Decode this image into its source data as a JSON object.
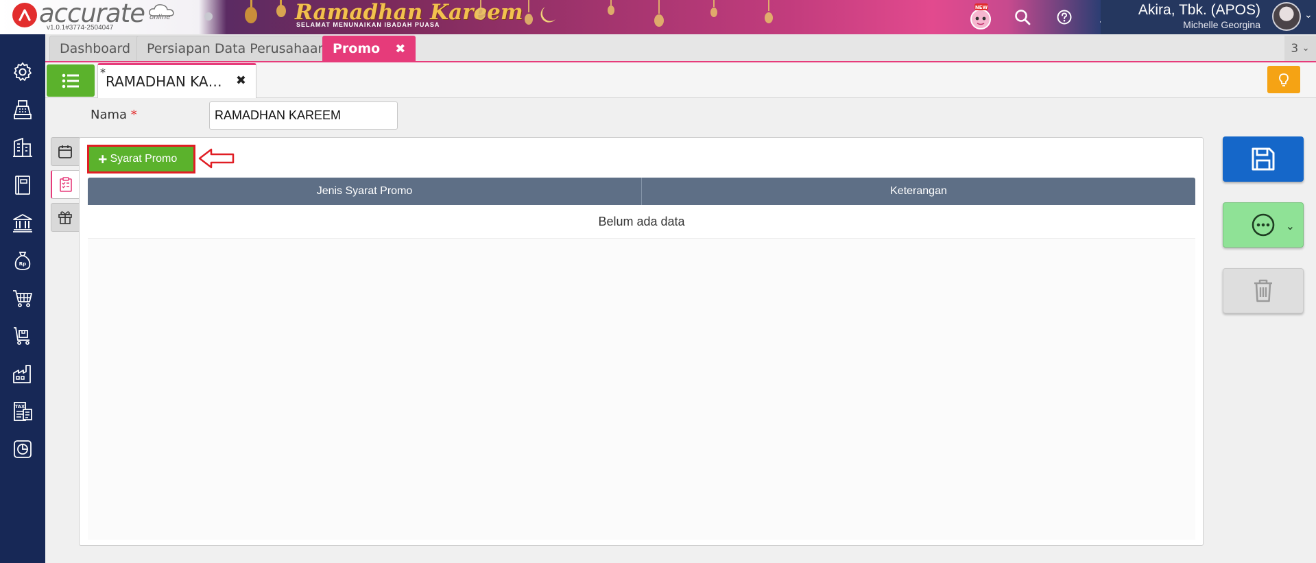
{
  "app": {
    "logo_text": "accurate",
    "logo_online": "online",
    "version": "v1.0.1#3774-2504047",
    "banner_title": "Ramadhan Kareem",
    "banner_subtitle": "SELAMAT MENUNAIKAN IBADAH PUASA",
    "new_badge": "NEW"
  },
  "user": {
    "company": "Akira, Tbk. (APOS)",
    "name": "Michelle Georgina"
  },
  "sidebar": {
    "items": [
      {
        "icon": "gear-icon"
      },
      {
        "icon": "cash-register-icon"
      },
      {
        "icon": "building-icon"
      },
      {
        "icon": "ledger-book-icon"
      },
      {
        "icon": "bank-icon"
      },
      {
        "icon": "money-bag-icon"
      },
      {
        "icon": "shopping-cart-icon"
      },
      {
        "icon": "delivery-cart-icon"
      },
      {
        "icon": "factory-icon"
      },
      {
        "icon": "tax-document-icon"
      },
      {
        "icon": "report-chart-icon"
      }
    ]
  },
  "tabs": [
    {
      "label": "Dashboard"
    },
    {
      "label": "Persiapan Data Perusahaan"
    },
    {
      "label": "Promo",
      "active": true
    }
  ],
  "tab_count": "3",
  "doc_tab": {
    "modified_marker": "*",
    "label": "RAMADHAN KA…"
  },
  "form": {
    "nama_label": "Nama",
    "required_marker": "*",
    "nama_value": "RAMADHAN KAREEM"
  },
  "panel": {
    "add_button_label": "Syarat Promo",
    "columns": [
      "Jenis Syarat Promo",
      "Keterangan"
    ],
    "empty_message": "Belum ada data"
  },
  "colors": {
    "accent": "#e63b7a",
    "green": "#5bb22c",
    "save_blue": "#1567c9",
    "sidebar": "#172856",
    "table_header": "#5e6f86",
    "highlight_red": "#e01e24"
  }
}
